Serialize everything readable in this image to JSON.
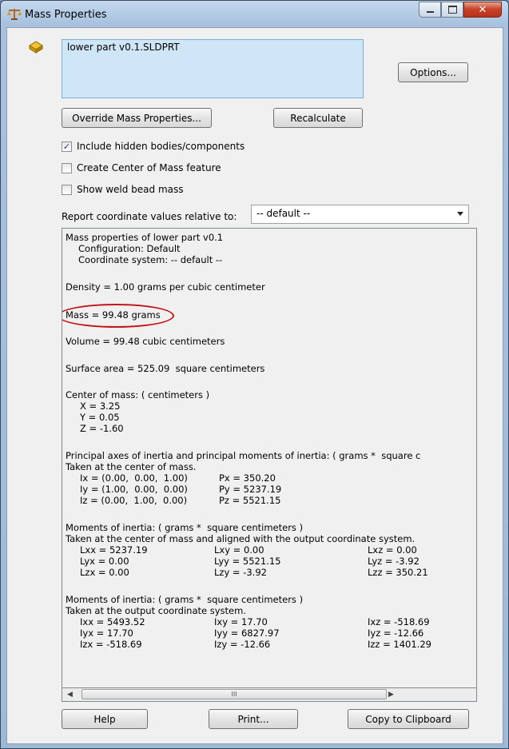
{
  "window": {
    "title": "Mass Properties"
  },
  "list": {
    "item": "lower part v0.1.SLDPRT"
  },
  "buttons": {
    "options": "Options...",
    "override": "Override Mass Properties...",
    "recalculate": "Recalculate",
    "help": "Help",
    "print": "Print...",
    "copy": "Copy to Clipboard"
  },
  "checks": [
    {
      "label": "Include hidden bodies/components",
      "checked": true
    },
    {
      "label": "Create Center of Mass feature",
      "checked": false
    },
    {
      "label": "Show weld bead mass",
      "checked": false
    }
  ],
  "report": {
    "label": "Report coordinate values relative to:",
    "value": "-- default --"
  },
  "results": {
    "header": "Mass properties of lower part v0.1",
    "config": "Configuration: Default",
    "coord": "Coordinate system: -- default --",
    "density": "Density = 1.00 grams per cubic centimeter",
    "mass": "Mass = 99.48 grams",
    "volume": "Volume = 99.48 cubic centimeters",
    "surface": "Surface area = 525.09  square centimeters",
    "com_title": "Center of mass: ( centimeters )",
    "com_x": "X = 3.25",
    "com_y": "Y = 0.05",
    "com_z": "Z = -1.60",
    "principal_title": "Principal axes of inertia and principal moments of inertia: ( grams *  square c",
    "principal_sub": "Taken at the center of mass.",
    "ix": "Ix = (0.00,  0.00,  1.00)",
    "iy": "Iy = (1.00,  0.00,  0.00)",
    "iz": "Iz = (0.00,  1.00,  0.00)",
    "px": "Px = 350.20",
    "py": "Py = 5237.19",
    "pz": "Pz = 5521.15",
    "moi1_title": "Moments of inertia: ( grams *  square centimeters )",
    "moi1_sub": "Taken at the center of mass and aligned with the output coordinate system.",
    "moi1": [
      [
        "Lxx = 5237.19",
        "Lxy = 0.00",
        "Lxz = 0.00"
      ],
      [
        "Lyx = 0.00",
        "Lyy = 5521.15",
        "Lyz = -3.92"
      ],
      [
        "Lzx = 0.00",
        "Lzy = -3.92",
        "Lzz = 350.21"
      ]
    ],
    "moi2_title": "Moments of inertia: ( grams *  square centimeters )",
    "moi2_sub": "Taken at the output coordinate system.",
    "moi2": [
      [
        "Ixx = 5493.52",
        "Ixy = 17.70",
        "Ixz = -518.69"
      ],
      [
        "Iyx = 17.70",
        "Iyy = 6827.97",
        "Iyz = -12.66"
      ],
      [
        "Izx = -518.69",
        "Izy = -12.66",
        "Izz = 1401.29"
      ]
    ]
  },
  "scrollbar": {
    "thumb_grip": "III"
  }
}
